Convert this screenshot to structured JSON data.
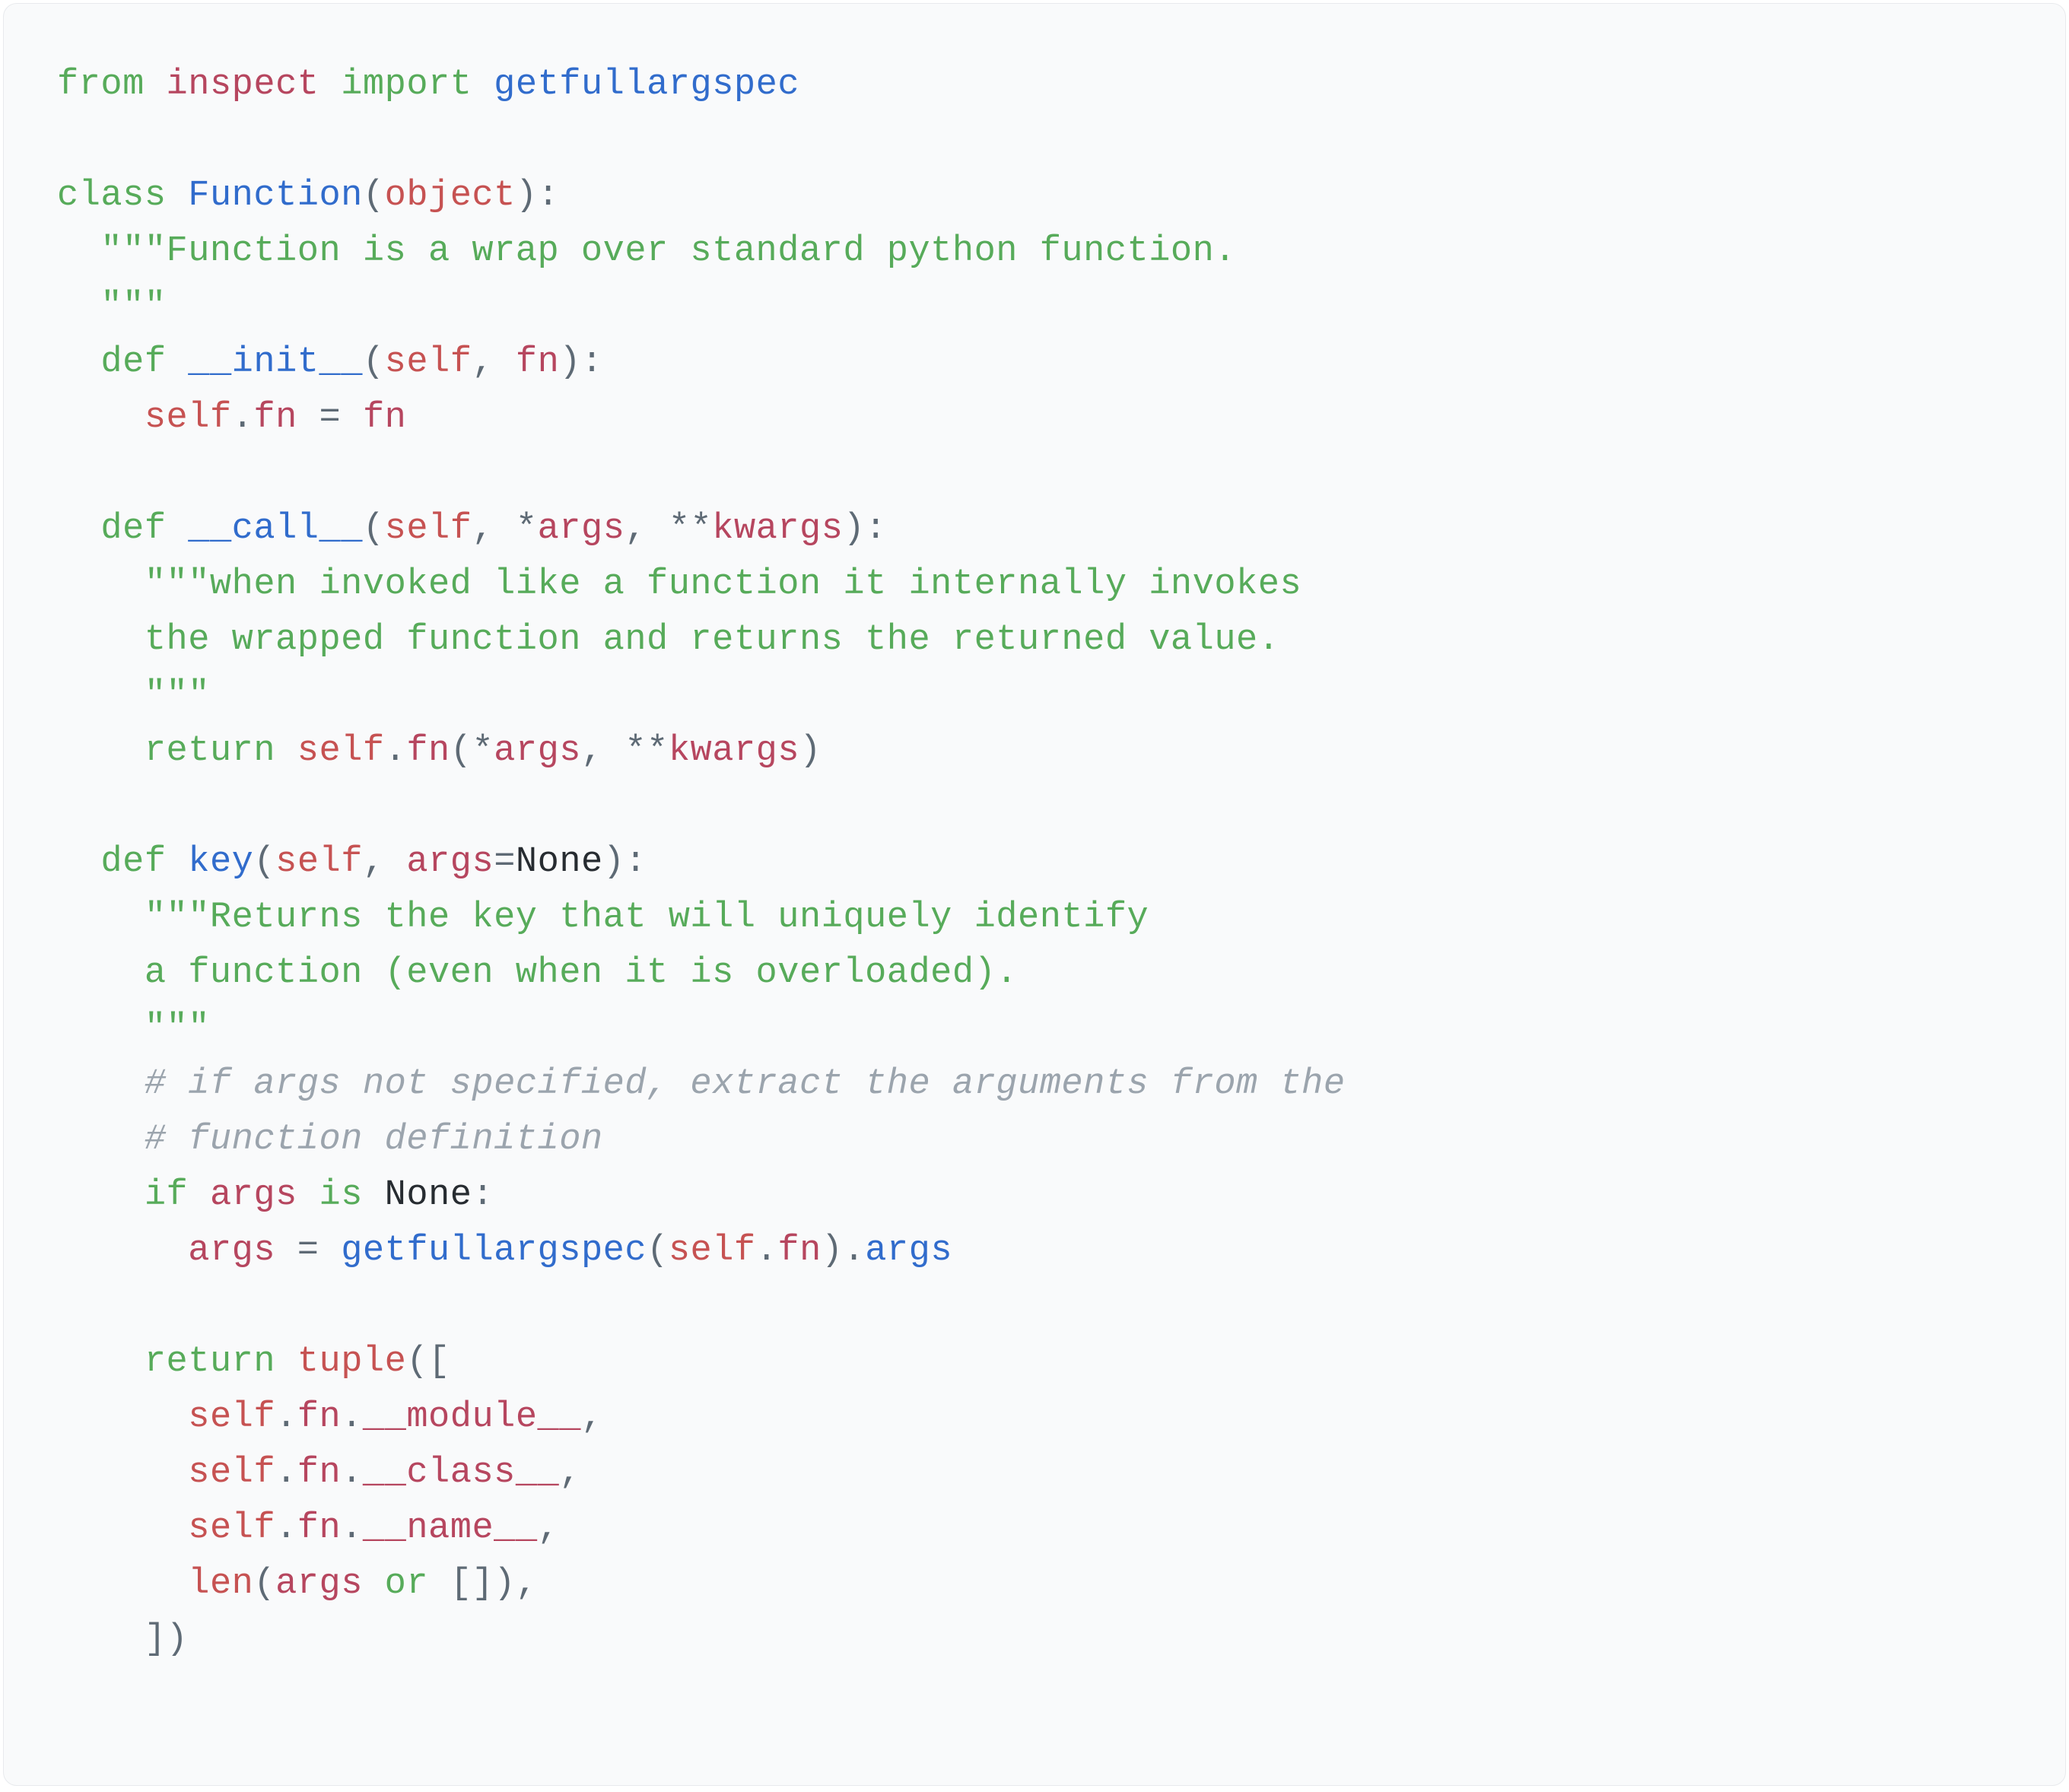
{
  "code": {
    "l1": {
      "from": "from",
      "mod": "inspect",
      "import": "import",
      "fn": "getfullargspec"
    },
    "l3": {
      "class": "class",
      "cls": "Function",
      "obj": "object"
    },
    "l4": "  \"\"\"Function is a wrap over standard python function.",
    "l5": "  \"\"\"",
    "l6": {
      "def": "def",
      "fn": "__init__",
      "self": "self",
      "param": "fn"
    },
    "l7": {
      "self": "self",
      "attr": "fn",
      "param": "fn"
    },
    "l9": {
      "def": "def",
      "fn": "__call__",
      "self": "self",
      "args": "args",
      "kwargs": "kwargs"
    },
    "l10": "    \"\"\"when invoked like a function it internally invokes",
    "l11": "    the wrapped function and returns the returned value.",
    "l12": "    \"\"\"",
    "l13": {
      "return": "return",
      "self": "self",
      "attr": "fn",
      "args": "args",
      "kwargs": "kwargs"
    },
    "l15": {
      "def": "def",
      "fn": "key",
      "self": "self",
      "param": "args",
      "none": "None"
    },
    "l16": "    \"\"\"Returns the key that will uniquely identify",
    "l17": "    a function (even when it is overloaded).",
    "l18": "    \"\"\"",
    "l19": "    # if args not specified, extract the arguments from the",
    "l20": "    # function definition",
    "l21": {
      "if": "if",
      "args": "args",
      "is": "is",
      "none": "None"
    },
    "l22": {
      "args": "args",
      "getfull": "getfullargspec",
      "self": "self",
      "fn": "fn",
      "attr": "args"
    },
    "l24": {
      "return": "return",
      "tuple": "tuple"
    },
    "l25": {
      "self": "self",
      "fn": "fn",
      "mod": "__module__"
    },
    "l26": {
      "self": "self",
      "fn": "fn",
      "cls": "__class__"
    },
    "l27": {
      "self": "self",
      "fn": "fn",
      "nm": "__name__"
    },
    "l28": {
      "len": "len",
      "args": "args",
      "or": "or"
    }
  }
}
